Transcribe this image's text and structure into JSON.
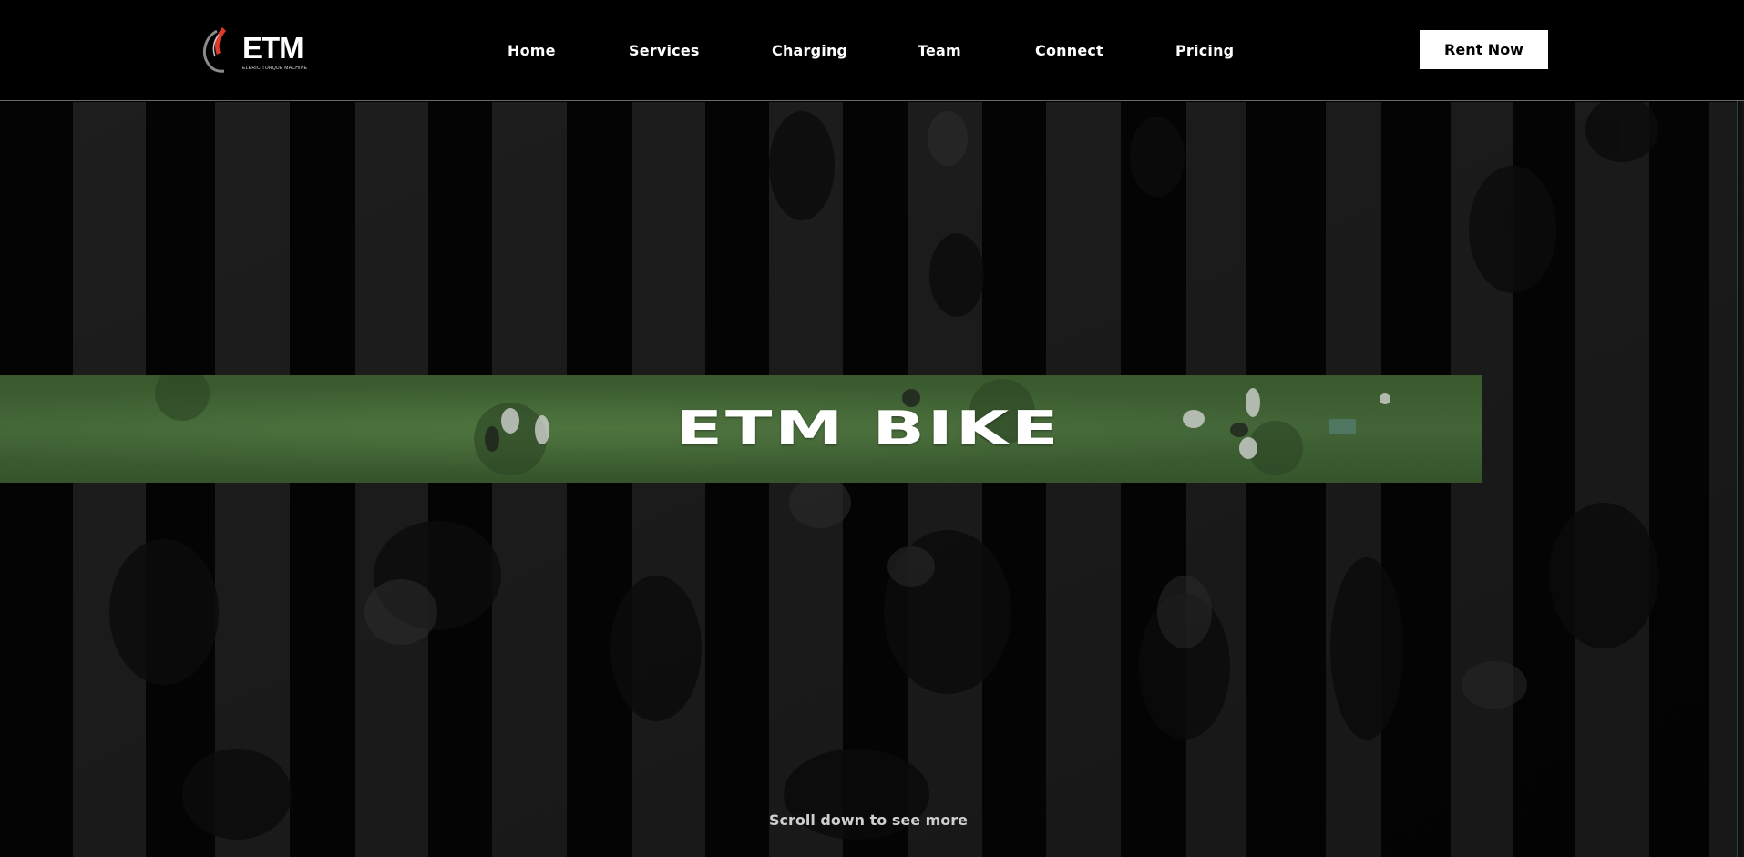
{
  "header": {
    "logo": {
      "text": "ETM",
      "tagline": "ELERIC TORQUE MACHINE",
      "accent_color": "#e03a2b"
    },
    "nav": [
      {
        "label": "Home"
      },
      {
        "label": "Services"
      },
      {
        "label": "Charging"
      },
      {
        "label": "Team"
      },
      {
        "label": "Connect"
      },
      {
        "label": "Pricing"
      }
    ],
    "cta_label": "Rent Now"
  },
  "hero": {
    "title": "ETM BIKE",
    "scroll_hint": "Scroll down to see more"
  },
  "colors": {
    "background": "#000000",
    "banner_green": "#426437",
    "cta_bg": "#ffffff",
    "cta_text": "#000000"
  }
}
